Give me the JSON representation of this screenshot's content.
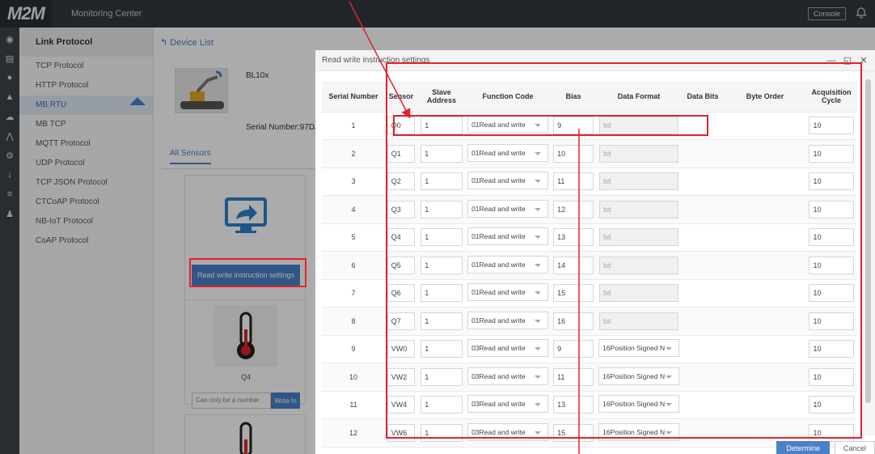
{
  "app": {
    "logo": "M2M",
    "title": "Monitoring Center",
    "console_label": "Console"
  },
  "sidebar": {
    "title": "Link Protocol",
    "items": [
      {
        "label": "TCP Protocol"
      },
      {
        "label": "HTTP Protocol"
      },
      {
        "label": "MB RTU"
      },
      {
        "label": "MB TCP"
      },
      {
        "label": "MQTT Protocol"
      },
      {
        "label": "UDP Protocol"
      },
      {
        "label": "TCP JSON Protocol"
      },
      {
        "label": "CTCoAP Protocol"
      },
      {
        "label": "NB-IoT Protocol"
      },
      {
        "label": "CoAP Protocol"
      }
    ],
    "active_index": 2
  },
  "page": {
    "back_label": "Device List",
    "device_name": "BL10x",
    "serial_label": "Serial Number:97DA",
    "tab": "All Sensors",
    "card1_button": "Read write instruction settings",
    "card2_label": "Q4",
    "card2_placeholder": "Can only be a number",
    "card2_button": "Write In"
  },
  "modal": {
    "title": "Read write instruction settings",
    "columns": [
      "Serial Number",
      "Sensor",
      "Slave Address",
      "Function Code",
      "Bias",
      "Data Format",
      "Data Bits",
      "Byte Order",
      "Acquisition Cycle"
    ],
    "rows": [
      {
        "serial": "1",
        "sensor": "Q0",
        "slave": "1",
        "func": "01Read and write",
        "bias": "9",
        "format": "bit",
        "format_disabled": true,
        "cycle": "10"
      },
      {
        "serial": "2",
        "sensor": "Q1",
        "slave": "1",
        "func": "01Read and write",
        "bias": "10",
        "format": "bit",
        "format_disabled": true,
        "cycle": "10"
      },
      {
        "serial": "3",
        "sensor": "Q2",
        "slave": "1",
        "func": "01Read and write",
        "bias": "11",
        "format": "bit",
        "format_disabled": true,
        "cycle": "10"
      },
      {
        "serial": "4",
        "sensor": "Q3",
        "slave": "1",
        "func": "01Read and write",
        "bias": "12",
        "format": "bit",
        "format_disabled": true,
        "cycle": "10"
      },
      {
        "serial": "5",
        "sensor": "Q4",
        "slave": "1",
        "func": "01Read and write",
        "bias": "13",
        "format": "bit",
        "format_disabled": true,
        "cycle": "10"
      },
      {
        "serial": "6",
        "sensor": "Q5",
        "slave": "1",
        "func": "01Read and write",
        "bias": "14",
        "format": "bit",
        "format_disabled": true,
        "cycle": "10"
      },
      {
        "serial": "7",
        "sensor": "Q6",
        "slave": "1",
        "func": "01Read and write",
        "bias": "15",
        "format": "bit",
        "format_disabled": true,
        "cycle": "10"
      },
      {
        "serial": "8",
        "sensor": "Q7",
        "slave": "1",
        "func": "01Read and write",
        "bias": "16",
        "format": "bit",
        "format_disabled": true,
        "cycle": "10"
      },
      {
        "serial": "9",
        "sensor": "VW0",
        "slave": "1",
        "func": "03Read and write",
        "bias": "9",
        "format": "16Position Signed N",
        "format_disabled": false,
        "cycle": "10"
      },
      {
        "serial": "10",
        "sensor": "VW2",
        "slave": "1",
        "func": "03Read and write",
        "bias": "11",
        "format": "16Position Signed N",
        "format_disabled": false,
        "cycle": "10"
      },
      {
        "serial": "11",
        "sensor": "VW4",
        "slave": "1",
        "func": "03Read and write",
        "bias": "13",
        "format": "16Position Signed N",
        "format_disabled": false,
        "cycle": "10"
      },
      {
        "serial": "12",
        "sensor": "VW6",
        "slave": "1",
        "func": "03Read and write",
        "bias": "15",
        "format": "16Position Signed N",
        "format_disabled": false,
        "cycle": "10"
      }
    ],
    "confirm_label": "Determine",
    "cancel_label": "Cancel"
  },
  "colors": {
    "accent": "#4a80c8",
    "annotation": "#e2222b",
    "topbar": "#343a40"
  }
}
